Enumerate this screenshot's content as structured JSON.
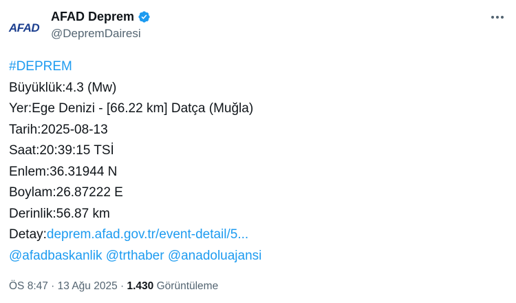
{
  "author": {
    "avatar_text": "AFAD",
    "display_name": "AFAD Deprem",
    "handle": "@DepremDairesi",
    "verified_icon": "verified-badge-icon"
  },
  "more_icon": "more-options-icon",
  "tweet": {
    "hashtag": "#DEPREM",
    "lines": [
      "Büyüklük:4.3 (Mw)",
      "Yer:Ege Denizi - [66.22 km] Datça (Muğla)",
      "Tarih:2025-08-13",
      "Saat:20:39:15 TSİ",
      "Enlem:36.31944 N",
      "Boylam:26.87222 E",
      "Derinlik:56.87 km"
    ],
    "detail_label": "Detay:",
    "detail_link": "deprem.afad.gov.tr/event-detail/5...",
    "mentions": [
      "@afadbaskanlik",
      "@trthaber",
      "@anadoluajansi"
    ]
  },
  "meta": {
    "time": "ÖS 8:47",
    "separator": " · ",
    "date": "13 Ağu 2025",
    "views_count": "1.430",
    "views_label": "Görüntüleme"
  },
  "colors": {
    "link": "#1d9bf0",
    "verified": "#1d9bf0",
    "avatar_text": "#1c3f8f",
    "secondary_text": "#536471"
  }
}
